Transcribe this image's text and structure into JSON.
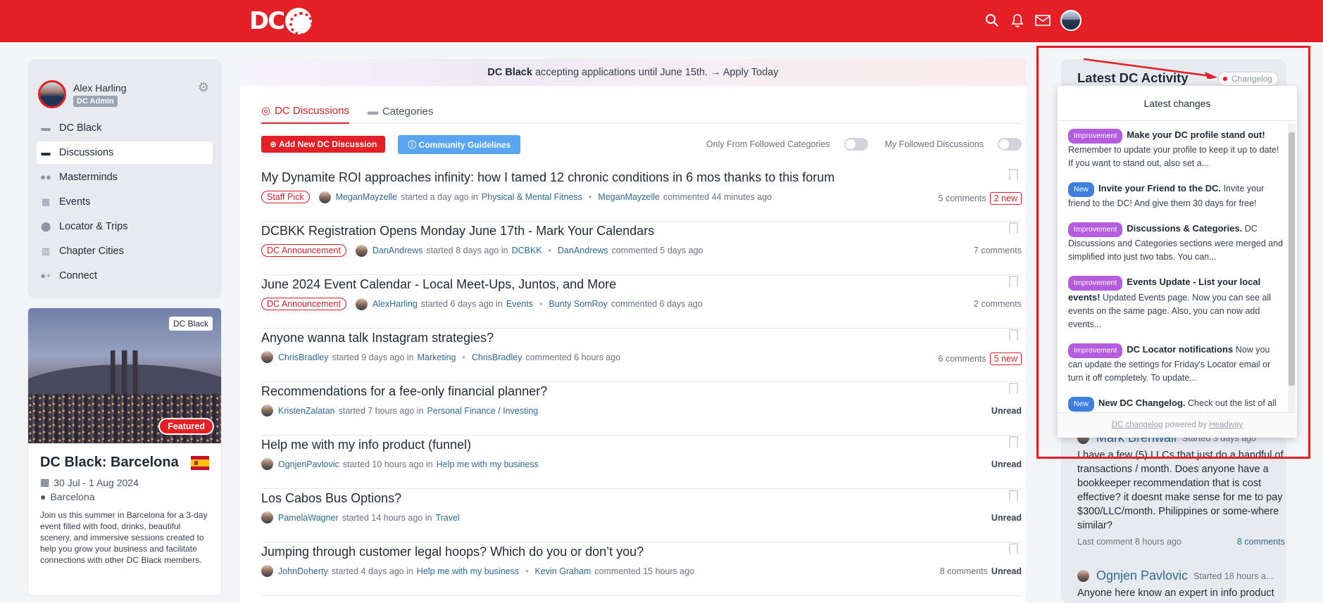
{
  "header": {
    "logo": "DC"
  },
  "user": {
    "name": "Alex Harling",
    "role": "DC Admin"
  },
  "sidebar": {
    "items": [
      {
        "label": "DC Black",
        "icon": "chat-bubble-icon"
      },
      {
        "label": "Discussions",
        "icon": "discussions-icon"
      },
      {
        "label": "Masterminds",
        "icon": "users-icon"
      },
      {
        "label": "Events",
        "icon": "calendar-icon"
      },
      {
        "label": "Locator & Trips",
        "icon": "location-pin-icon"
      },
      {
        "label": "Chapter Cities",
        "icon": "building-icon"
      },
      {
        "label": "Connect",
        "icon": "user-plus-icon"
      }
    ]
  },
  "event": {
    "tag": "DC Black",
    "featured": "Featured",
    "title": "DC Black: Barcelona",
    "dates": "30 Jul - 1 Aug 2024",
    "location": "Barcelona",
    "description": "Join us this summer in Barcelona for a 3-day event filled with food, drinks, beautiful scenery, and immersive sessions created to help you grow your business and facilitate connections with other DC Black members."
  },
  "banner": {
    "bold": "DC Black",
    "text": " accepting applications until June 15th. → Apply Today"
  },
  "tabs": [
    {
      "label": "DC Discussions"
    },
    {
      "label": "Categories"
    }
  ],
  "actions": {
    "add": "Add New DC Discussion",
    "guidelines": "Community Guidelines",
    "toggle1": "Only From Followed Categories",
    "toggle2": "My Followed Discussions"
  },
  "discussions": [
    {
      "title": "My Dynamite ROI approaches infinity: how I tamed 12 chronic conditions in 6 mos thanks to this forum",
      "pill": "Staff Pick",
      "author": "MeganMayzelle",
      "started": "started a day ago in",
      "category": "Physical & Mental Fitness",
      "commenter": "MeganMayzelle",
      "commented": "commented 44 minutes ago",
      "comments": "5 comments",
      "new": "2 new"
    },
    {
      "title": "DCBKK Registration Opens Monday June 17th - Mark Your Calendars",
      "pill": "DC Announcement",
      "author": "DanAndrews",
      "started": "started 8 days ago in",
      "category": "DCBKK",
      "commenter": "DanAndrews",
      "commented": "commented 5 days ago",
      "comments": "7 comments",
      "new": ""
    },
    {
      "title": "June 2024 Event Calendar - Local Meet-Ups, Juntos, and More",
      "pill": "DC Announcement",
      "author": "AlexHarling",
      "started": "started 6 days ago in",
      "category": "Events",
      "commenter": "Bunty SomRoy",
      "commented": "commented 6 days ago",
      "comments": "2 comments",
      "new": ""
    },
    {
      "title": "Anyone wanna talk Instagram strategies?",
      "pill": "",
      "author": "ChrisBradley",
      "started": "started 9 days ago in",
      "category": "Marketing",
      "commenter": "ChrisBradley",
      "commented": "commented 6 hours ago",
      "comments": "6 comments",
      "new": "5 new"
    },
    {
      "title": "Recommendations for a fee-only financial planner?",
      "pill": "",
      "author": "KristenZalatan",
      "started": "started 7 hours ago in",
      "category": "Personal Finance / Investing",
      "commenter": "",
      "commented": "",
      "comments": "",
      "new": "",
      "unread": "Unread"
    },
    {
      "title": "Help me with my info product (funnel)",
      "pill": "",
      "author": "OgnjenPavlovic",
      "started": "started 10 hours ago in",
      "category": "Help me with my business",
      "commenter": "",
      "commented": "",
      "comments": "",
      "new": "",
      "unread": "Unread"
    },
    {
      "title": "Los Cabos Bus Options?",
      "pill": "",
      "author": "PamelaWagner",
      "started": "started 14 hours ago in",
      "category": "Travel",
      "commenter": "",
      "commented": "",
      "comments": "",
      "new": "",
      "unread": "Unread"
    },
    {
      "title": "Jumping through customer legal hoops? Which do you or don’t you?",
      "pill": "",
      "author": "JohnDoherty",
      "started": "started 4 days ago in",
      "category": "Help me with my business",
      "commenter": "Kevin Graham",
      "commented": "commented 15 hours ago",
      "comments": "8 comments",
      "new": "",
      "unread": "Unread"
    }
  ],
  "activity": {
    "title": "Latest DC Activity",
    "changelog": "Changelog",
    "items": [
      {
        "name": "Mark Brenwall",
        "sub": "Started 3 days ago",
        "text": "I have a few (5) LLCs that just do a handful of transactions / month. Does anyone have a bookkeeper recommendation that is cost effective? it doesnt make sense for me to pay $300/LLC/month. Philippines or some-where similar?",
        "last": "Last comment 8 hours ago",
        "comments": "8 comments"
      },
      {
        "name": "Ognjen Pavlovic",
        "sub": "Started 18 hours a...",
        "text": "Anyone here know an expert in info product"
      }
    ]
  },
  "changelog_popup": {
    "title": "Latest changes",
    "items": [
      {
        "badge": "Improvement",
        "kind": "imp",
        "title": "Make your DC profile stand out!",
        "text": "Remember to update your profile to keep it up to date! If you want to stand out, also set a..."
      },
      {
        "badge": "New",
        "kind": "new",
        "title": "Invite your Friend to the DC.",
        "text": "Invite your friend to the DC! And give them 30 days for free!"
      },
      {
        "badge": "Improvement",
        "kind": "imp",
        "title": "Discussions & Categories.",
        "text": "DC Discussions and Categories sections were merged and simplified into just two tabs. You can..."
      },
      {
        "badge": "Improvement",
        "kind": "imp",
        "title": "Events Update - List your local events!",
        "text": "Updated Events page. Now you can see all events on the same page. Also, you can now add events..."
      },
      {
        "badge": "Improvement",
        "kind": "imp",
        "title": "DC Locator notifications",
        "text": "Now you can update the settings for Friday's Locator email or turn it off completely. To update..."
      },
      {
        "badge": "New",
        "kind": "new",
        "title": "New DC Changelog.",
        "text": "Check out the list of all previously added features. Going forward, all new feature upd..."
      }
    ],
    "footer_link": "DC changelog",
    "footer_text": " powered by ",
    "footer_brand": "Headway"
  },
  "colors": {
    "brand": "#e41f26",
    "link": "#2d6a96",
    "improvement": "#b65ce0",
    "new": "#3f7fe0"
  }
}
